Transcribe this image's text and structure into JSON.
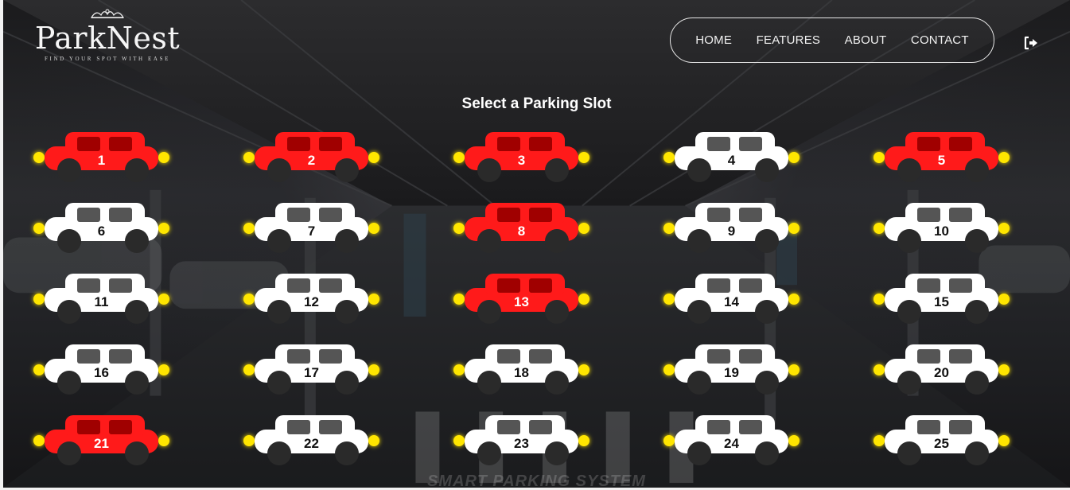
{
  "brand": {
    "name": "ParkNest",
    "tagline": "FIND YOUR SPOT WITH EASE"
  },
  "nav": {
    "items": [
      {
        "label": "HOME"
      },
      {
        "label": "FEATURES"
      },
      {
        "label": "ABOUT"
      },
      {
        "label": "CONTACT"
      }
    ]
  },
  "logout": {
    "icon": "logout-icon"
  },
  "page_title": "Select a Parking Slot",
  "background_text": "SMART PARKING SYSTEM",
  "colors": {
    "occupied": "#ff1a1a",
    "available": "#ffffff",
    "headlight": "#ffe600",
    "wheel": "#2a2a2a"
  },
  "slots": [
    {
      "number": "1",
      "status": "occupied"
    },
    {
      "number": "2",
      "status": "occupied"
    },
    {
      "number": "3",
      "status": "occupied"
    },
    {
      "number": "4",
      "status": "available"
    },
    {
      "number": "5",
      "status": "occupied"
    },
    {
      "number": "6",
      "status": "available"
    },
    {
      "number": "7",
      "status": "available"
    },
    {
      "number": "8",
      "status": "occupied"
    },
    {
      "number": "9",
      "status": "available"
    },
    {
      "number": "10",
      "status": "available"
    },
    {
      "number": "11",
      "status": "available"
    },
    {
      "number": "12",
      "status": "available"
    },
    {
      "number": "13",
      "status": "occupied"
    },
    {
      "number": "14",
      "status": "available"
    },
    {
      "number": "15",
      "status": "available"
    },
    {
      "number": "16",
      "status": "available"
    },
    {
      "number": "17",
      "status": "available"
    },
    {
      "number": "18",
      "status": "available"
    },
    {
      "number": "19",
      "status": "available"
    },
    {
      "number": "20",
      "status": "available"
    },
    {
      "number": "21",
      "status": "occupied"
    },
    {
      "number": "22",
      "status": "available"
    },
    {
      "number": "23",
      "status": "available"
    },
    {
      "number": "24",
      "status": "available"
    },
    {
      "number": "25",
      "status": "available"
    }
  ]
}
